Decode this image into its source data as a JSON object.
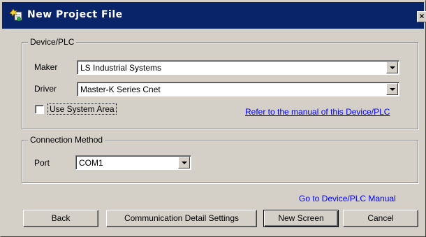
{
  "window": {
    "title": "New Project File",
    "close_glyph": "×"
  },
  "device_group": {
    "legend": "Device/PLC",
    "maker_label": "Maker",
    "maker_value": "LS Industrial Systems",
    "driver_label": "Driver",
    "driver_value": "Master-K Series Cnet",
    "use_system_area_label": "Use System Area",
    "use_system_area_checked": false,
    "manual_link": "Refer to the manual of this Device/PLC"
  },
  "connection_group": {
    "legend": "Connection Method",
    "port_label": "Port",
    "port_value": "COM1"
  },
  "goto_manual_link": "Go to Device/PLC Manual",
  "buttons": {
    "back": "Back",
    "comm_settings": "Communication Detail Settings",
    "new_screen": "New Screen",
    "cancel": "Cancel"
  },
  "colors": {
    "title_bar": "#0a246a",
    "dialog_face": "#d4d0c8",
    "link": "#0000ff"
  },
  "icons": {
    "title": "project-file-icon",
    "close": "close-icon",
    "dropdown": "chevron-down-icon"
  }
}
